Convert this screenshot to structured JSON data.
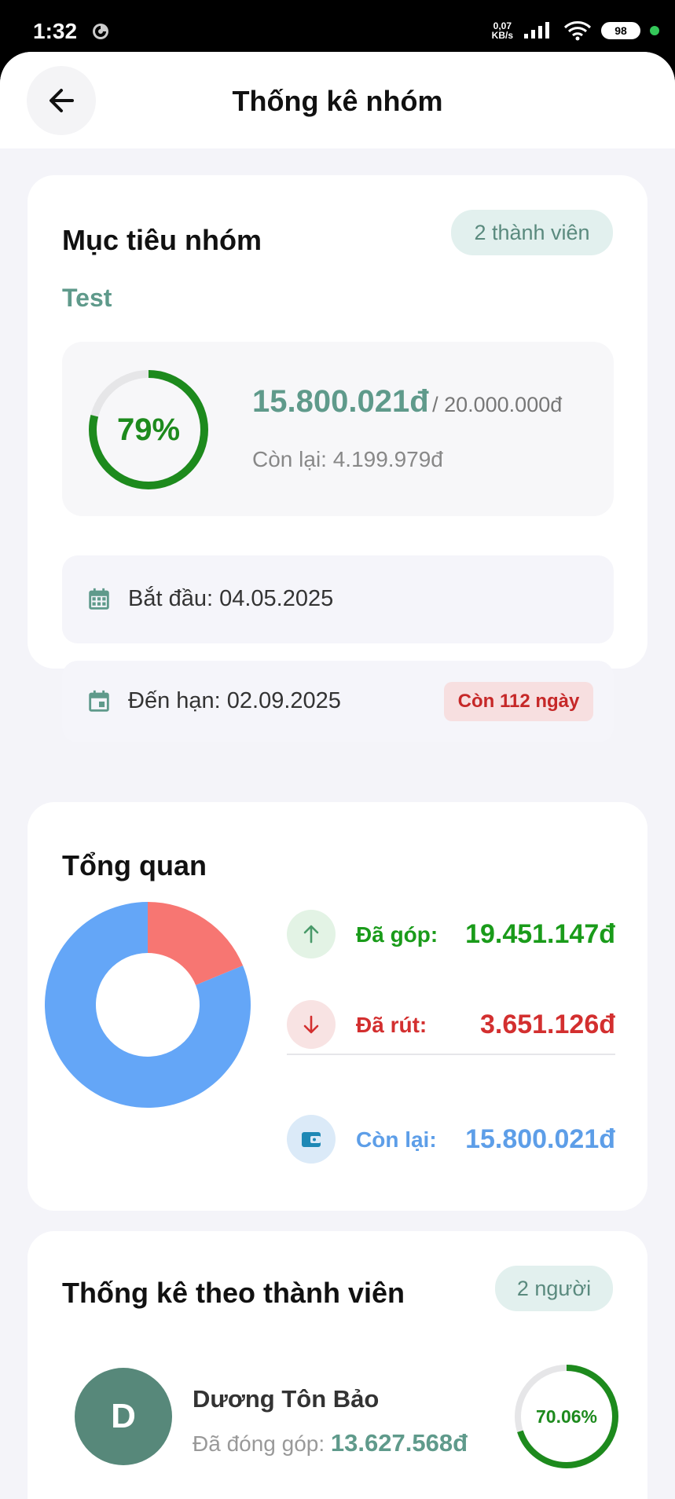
{
  "status_bar": {
    "time": "1:32",
    "speed_value": "0,07",
    "speed_unit": "KB/s",
    "battery": "98"
  },
  "appbar": {
    "title": "Thống kê nhóm"
  },
  "goal_card": {
    "title": "Mục tiêu nhóm",
    "members_pill": "2 thành viên",
    "goal_name": "Test",
    "progress_percent_label": "79%",
    "progress_fraction": 0.79,
    "current_amount": "15.800.021đ",
    "target_amount": "/ 20.000.000đ",
    "remaining": "Còn lại: 4.199.979đ",
    "start_date": "Bắt đầu: 04.05.2025",
    "due_date": "Đến hạn: 02.09.2025",
    "days_left": "Còn 112 ngày"
  },
  "overview": {
    "title": "Tổng quan",
    "contributed_label": "Đã góp:",
    "contributed_value": "19.451.147đ",
    "withdrawn_label": "Đã rút:",
    "withdrawn_value": "3.651.126đ",
    "balance_label": "Còn lại:",
    "balance_value": "15.800.021đ",
    "colors": {
      "contributed": "#1a9b1a",
      "withdrawn": "#d32f2f",
      "balance": "#5d9ee8"
    }
  },
  "chart_data": {
    "type": "pie",
    "categories": [
      "Còn lại",
      "Đã rút"
    ],
    "values": [
      15800021,
      3651126
    ],
    "colors": [
      "#64a6f7",
      "#f77672"
    ]
  },
  "members_card": {
    "title": "Thống kê theo thành viên",
    "count_pill": "2 người",
    "members": [
      {
        "initial": "D",
        "name": "Dương Tôn Bảo",
        "contrib_label": "Đã đóng góp:",
        "contrib_value": "13.627.568đ",
        "percent_label": "70.06%",
        "percent_fraction": 0.7006
      }
    ]
  }
}
